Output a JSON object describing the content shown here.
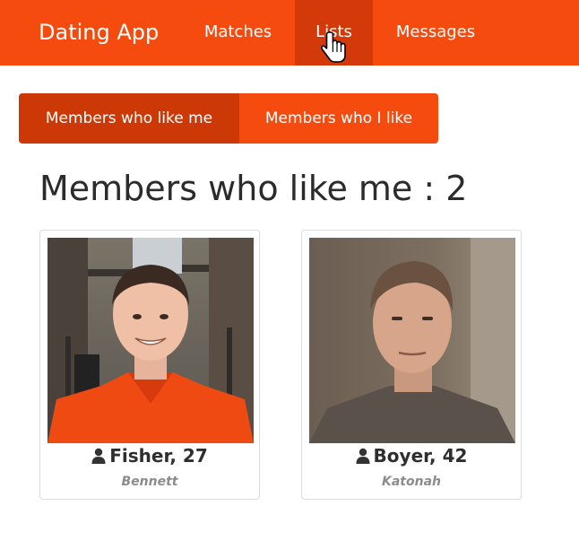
{
  "navbar": {
    "brand": "Dating App",
    "items": [
      {
        "label": "Matches",
        "active": false
      },
      {
        "label": "Lists",
        "active": true
      },
      {
        "label": "Messages",
        "active": false
      }
    ],
    "color": "#f64b0e",
    "active_color": "#d33909"
  },
  "filter": {
    "buttons": [
      {
        "label": "Members who like me",
        "active": true
      },
      {
        "label": "Members who I like",
        "active": false
      }
    ]
  },
  "page": {
    "title": "Members who like me : 2"
  },
  "members": [
    {
      "name_age": "Fisher, 27",
      "city": "Bennett",
      "icon": "user-icon"
    },
    {
      "name_age": "Boyer, 42",
      "city": "Katonah",
      "icon": "user-icon"
    }
  ]
}
